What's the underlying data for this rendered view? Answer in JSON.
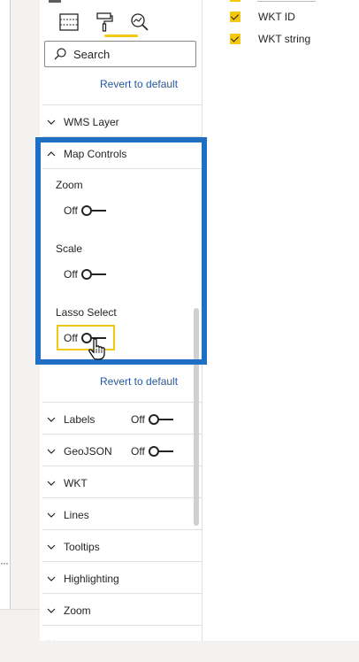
{
  "format_pane": {
    "tool_icons": [
      {
        "name": "fields-icon"
      },
      {
        "name": "format-paint-roller-icon",
        "active": true
      },
      {
        "name": "analytics-magnifier-icon"
      }
    ],
    "search": {
      "placeholder": "Search"
    },
    "revert_top": "Revert to default",
    "sections": {
      "wms_layer": {
        "label": "WMS Layer",
        "expanded": false
      },
      "map_controls": {
        "label": "Map Controls",
        "expanded": true,
        "controls": [
          {
            "label": "Zoom",
            "toggle": "Off"
          },
          {
            "label": "Scale",
            "toggle": "Off"
          },
          {
            "label": "Lasso Select",
            "toggle": "Off",
            "focused": true
          }
        ],
        "revert": "Revert to default"
      },
      "labels": {
        "label": "Labels",
        "toggle": "Off"
      },
      "geojson": {
        "label": "GeoJSON",
        "toggle": "Off"
      },
      "wkt": {
        "label": "WKT"
      },
      "lines": {
        "label": "Lines"
      },
      "tooltips": {
        "label": "Tooltips"
      },
      "highlighting": {
        "label": "Highlighting"
      },
      "zoom": {
        "label": "Zoom"
      }
    }
  },
  "fields_pane": {
    "items": [
      {
        "label": "WKT ID",
        "checked": true
      },
      {
        "label": "WKT string",
        "checked": true
      }
    ]
  },
  "colors": {
    "accent_yellow": "#f2c811",
    "highlight_blue": "#1f6fc5",
    "link_blue": "#2b579a"
  }
}
